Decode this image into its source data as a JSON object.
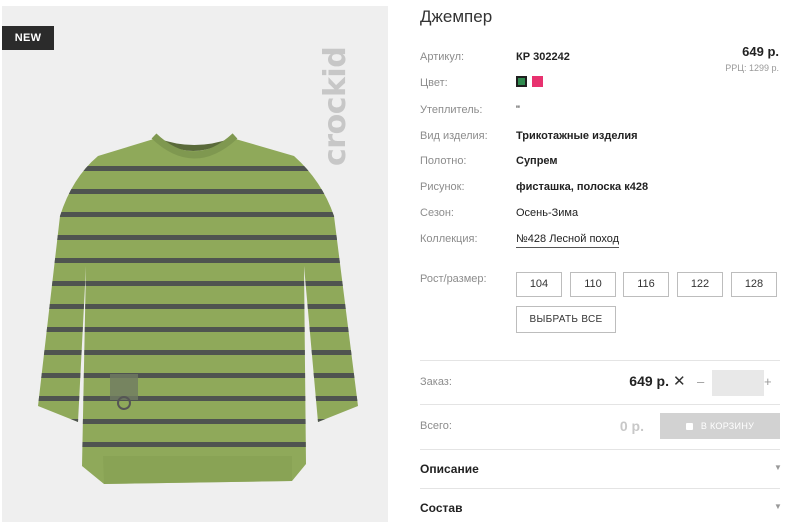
{
  "product": {
    "title": "Джемпер",
    "badge": "NEW",
    "brand": "crockid",
    "price": "649 р.",
    "rrp": "РРЦ: 1299 р."
  },
  "attributes": [
    {
      "label": "Артикул:",
      "value": "КР 302242"
    },
    {
      "label": "Цвет:",
      "value": ""
    },
    {
      "label": "Утеплитель:",
      "value": "\""
    },
    {
      "label": "Вид изделия:",
      "value": "Трикотажные изделия"
    },
    {
      "label": "Полотно:",
      "value": "Супрем"
    },
    {
      "label": "Рисунок:",
      "value": "фисташка, полоска к428"
    },
    {
      "label": "Сезон:",
      "value": "Осень-Зима"
    },
    {
      "label": "Коллекция:",
      "value": "№428 Лесной поход"
    }
  ],
  "colors": [
    "#2f8a4e",
    "#e8326f"
  ],
  "sizes": {
    "label": "Рост/размер:",
    "options": [
      "104",
      "110",
      "116",
      "122",
      "128"
    ],
    "select_all": "ВЫБРАТЬ ВСЕ"
  },
  "order": {
    "label": "Заказ:",
    "price": "649 р.",
    "times": "✕",
    "minus": "–",
    "plus": "+",
    "quantity": ""
  },
  "total": {
    "label": "Всего:",
    "value": "0 р.",
    "cart_button": "В КОРЗИНУ"
  },
  "accordion": [
    {
      "title": "Описание",
      "arrow": "▼"
    },
    {
      "title": "Состав",
      "arrow": "▼"
    }
  ]
}
